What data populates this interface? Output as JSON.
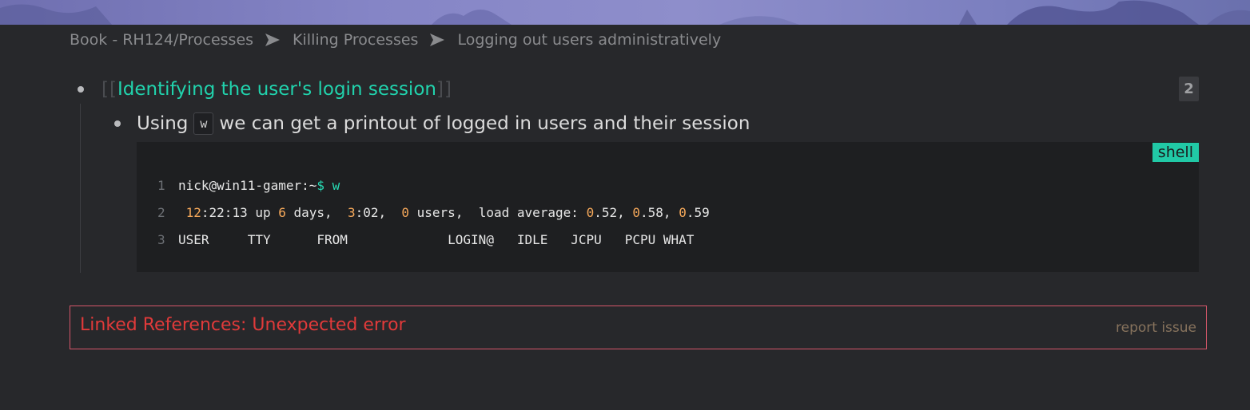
{
  "breadcrumb": {
    "items": [
      {
        "label": "Book - RH124/Processes"
      },
      {
        "label": "Killing Processes"
      },
      {
        "label": "Logging out users administratively"
      }
    ],
    "separator_icon": "arrow-right-icon"
  },
  "block1": {
    "bracket_open": "[[",
    "page_ref": "Identifying the user's login session",
    "bracket_close": "]]",
    "ref_count": "2"
  },
  "block2": {
    "text_before": "Using",
    "inline_code": "w",
    "text_after": "we can get a printout of logged in users and their session"
  },
  "code_block": {
    "language": "shell",
    "lines": [
      {
        "num": "1",
        "text": "nick@win11-gamer:~$ w"
      },
      {
        "num": "2",
        "text": " 12:22:13 up 6 days,  3:02,  0 users,  load average: 0.52, 0.58, 0.59"
      },
      {
        "num": "3",
        "text": "USER     TTY      FROM             LOGIN@   IDLE   JCPU   PCPU WHAT"
      }
    ]
  },
  "linked_references": {
    "error": "Linked References: Unexpected error",
    "report_link": "report issue"
  },
  "colors": {
    "background": "#27282b",
    "page_ref": "#21d3ad",
    "code_bg": "#1e1f21",
    "badge": "#21c9a6",
    "number": "#f5a85a",
    "error": "#e03a3a",
    "error_border": "#d5566a"
  }
}
